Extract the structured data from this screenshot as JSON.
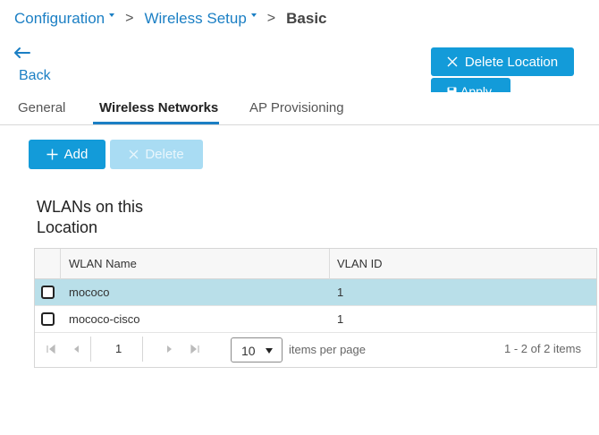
{
  "breadcrumb": {
    "items": [
      {
        "label": "Configuration"
      },
      {
        "label": "Wireless Setup"
      }
    ],
    "separator": ">",
    "current": "Basic"
  },
  "back": {
    "label": "Back",
    "icon": "left-arrow-icon"
  },
  "actions": {
    "delete_location_label": "Delete Location",
    "apply_label": "Apply"
  },
  "tabs": [
    {
      "label": "General",
      "active": false
    },
    {
      "label": "Wireless Networks",
      "active": true
    },
    {
      "label": "AP Provisioning",
      "active": false
    }
  ],
  "toolbar": {
    "add_label": "Add",
    "delete_label": "Delete",
    "delete_disabled": true
  },
  "section": {
    "title": "WLANs on this Location"
  },
  "grid": {
    "columns": [
      "WLAN Name",
      "VLAN ID"
    ],
    "rows": [
      {
        "wlan_name": "mococo",
        "vlan_id": "1",
        "selected": true,
        "checked": false
      },
      {
        "wlan_name": "mococo-cisco",
        "vlan_id": "1",
        "selected": false,
        "checked": false
      }
    ],
    "pager": {
      "current_page": "1",
      "page_size": "10",
      "items_per_page_label": "items per page",
      "range_text": "1 - 2 of 2 items"
    }
  },
  "colors": {
    "accent": "#139bd9",
    "link": "#1b7fc4",
    "disabled": "#a9dcf3",
    "row_selected": "#b9dfe9"
  }
}
